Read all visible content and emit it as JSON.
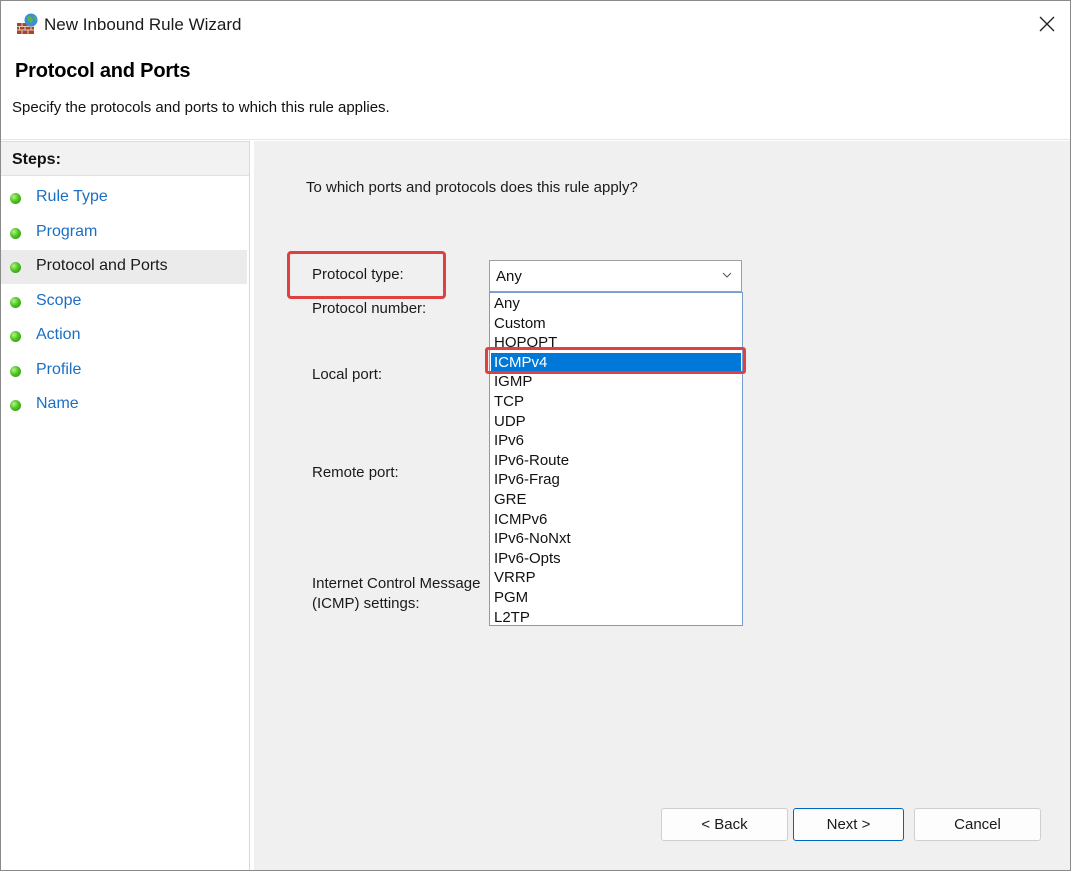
{
  "window": {
    "title": "New Inbound Rule Wizard"
  },
  "header": {
    "title": "Protocol and Ports",
    "subtitle": "Specify the protocols and ports to which this rule applies."
  },
  "steps": {
    "heading": "Steps:",
    "items": [
      {
        "label": "Rule Type"
      },
      {
        "label": "Program"
      },
      {
        "label": "Protocol and Ports",
        "active": true
      },
      {
        "label": "Scope"
      },
      {
        "label": "Action"
      },
      {
        "label": "Profile"
      },
      {
        "label": "Name"
      }
    ]
  },
  "content": {
    "question": "To which ports and protocols does this rule apply?",
    "protocol_type_label": "Protocol type:",
    "protocol_number_label": "Protocol number:",
    "local_port_label": "Local port:",
    "remote_port_label": "Remote port:",
    "icmp_label_line1": "Internet Control Message",
    "icmp_label_line2": "(ICMP) settings:",
    "protocol_select": {
      "value": "Any",
      "options": [
        "Any",
        "Custom",
        "HOPOPT",
        "ICMPv4",
        "IGMP",
        "TCP",
        "UDP",
        "IPv6",
        "IPv6-Route",
        "IPv6-Frag",
        "GRE",
        "ICMPv6",
        "IPv6-NoNxt",
        "IPv6-Opts",
        "VRRP",
        "PGM",
        "L2TP"
      ],
      "highlighted": "ICMPv4"
    }
  },
  "buttons": {
    "back": "< Back",
    "next": "Next >",
    "cancel": "Cancel"
  },
  "colors": {
    "accent": "#0078d7",
    "annotation": "#e04040",
    "link": "#1a6fc4",
    "step_dot": "#4fc421"
  },
  "icons": {
    "app": "firewall-globe-icon",
    "close": "close-icon",
    "dropdown": "chevron-down-icon",
    "step": "green-dot-icon"
  }
}
